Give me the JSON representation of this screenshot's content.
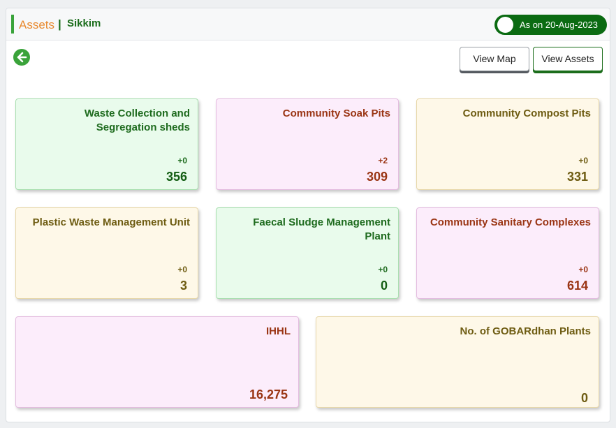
{
  "header": {
    "title": "Assets",
    "separator": "|",
    "state": "Sikkim",
    "date_label": "As on 20-Aug-2023"
  },
  "toolbar": {
    "view_map_label": "View Map",
    "view_assets_label": "View Assets"
  },
  "cards": [
    {
      "title_line1": "Waste Collection and",
      "title_line2": "Segregation sheds",
      "delta": "+0",
      "value": "356",
      "theme": "green"
    },
    {
      "title_line1": "Community Soak Pits",
      "title_line2": "",
      "delta": "+2",
      "value": "309",
      "theme": "pink"
    },
    {
      "title_line1": "Community Compost Pits",
      "title_line2": "",
      "delta": "+0",
      "value": "331",
      "theme": "cream"
    },
    {
      "title_line1": "Plastic Waste Management Unit",
      "title_line2": "",
      "delta": "+0",
      "value": "3",
      "theme": "cream"
    },
    {
      "title_line1": "Faecal Sludge Management",
      "title_line2": "Plant",
      "delta": "+0",
      "value": "0",
      "theme": "green"
    },
    {
      "title_line1": "Community Sanitary Complexes",
      "title_line2": "",
      "delta": "+0",
      "value": "614",
      "theme": "pink"
    },
    {
      "title_line1": "IHHL",
      "title_line2": "",
      "delta": "",
      "value": "16,275",
      "theme": "pink"
    },
    {
      "title_line1": "No. of GOBARdhan Plants",
      "title_line2": "",
      "delta": "",
      "value": "0",
      "theme": "cream"
    }
  ],
  "icons": {
    "back": "arrow-left-circle-icon",
    "toggle": "toggle-knob"
  },
  "colors": {
    "accent_green": "#0b6b12",
    "title_orange": "#e8892e",
    "green_card": "#e9fbec",
    "pink_card": "#fcedfb",
    "cream_card": "#fef8e8"
  }
}
